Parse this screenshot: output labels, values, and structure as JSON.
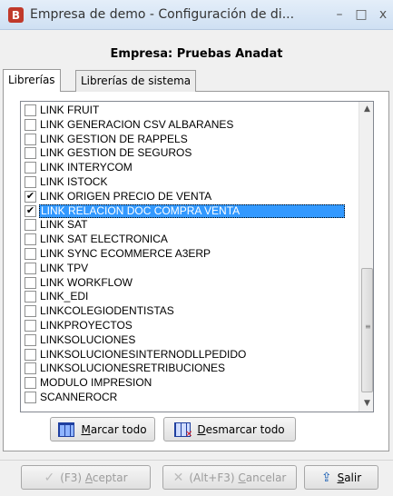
{
  "window": {
    "title": "Empresa de demo - Configuración de di...",
    "app_icon_letter": "B",
    "minimize_glyph": "–",
    "maximize_glyph": "□",
    "close_glyph": "x"
  },
  "company_label": "Empresa: Pruebas Anadat",
  "tabs": [
    {
      "label": "Librerías",
      "active": true
    },
    {
      "label": "Librerías de sistema",
      "active": false
    }
  ],
  "libraries": [
    {
      "label": "LINK FRUIT",
      "checked": false,
      "selected": false
    },
    {
      "label": "LINK GENERACION CSV ALBARANES",
      "checked": false,
      "selected": false
    },
    {
      "label": "LINK GESTION DE RAPPELS",
      "checked": false,
      "selected": false
    },
    {
      "label": "LINK GESTION DE SEGUROS",
      "checked": false,
      "selected": false
    },
    {
      "label": "LINK INTERYCOM",
      "checked": false,
      "selected": false
    },
    {
      "label": "LINK ISTOCK",
      "checked": false,
      "selected": false
    },
    {
      "label": "LINK ORIGEN PRECIO DE VENTA",
      "checked": true,
      "selected": false
    },
    {
      "label": "LINK RELACION DOC COMPRA VENTA",
      "checked": true,
      "selected": true
    },
    {
      "label": "LINK SAT",
      "checked": false,
      "selected": false
    },
    {
      "label": "LINK SAT ELECTRONICA",
      "checked": false,
      "selected": false
    },
    {
      "label": "LINK SYNC ECOMMERCE A3ERP",
      "checked": false,
      "selected": false
    },
    {
      "label": "LINK TPV",
      "checked": false,
      "selected": false
    },
    {
      "label": "LINK WORKFLOW",
      "checked": false,
      "selected": false
    },
    {
      "label": "LINK_EDI",
      "checked": false,
      "selected": false
    },
    {
      "label": "LINKCOLEGIODENTISTAS",
      "checked": false,
      "selected": false
    },
    {
      "label": "LINKPROYECTOS",
      "checked": false,
      "selected": false
    },
    {
      "label": "LINKSOLUCIONES",
      "checked": false,
      "selected": false
    },
    {
      "label": "LINKSOLUCIONESINTERNODLLPEDIDO",
      "checked": false,
      "selected": false
    },
    {
      "label": "LINKSOLUCIONESRETRIBUCIONES",
      "checked": false,
      "selected": false
    },
    {
      "label": "MODULO IMPRESION",
      "checked": false,
      "selected": false
    },
    {
      "label": "SCANNEROCR",
      "checked": false,
      "selected": false
    }
  ],
  "scrollbar": {
    "position_fraction": 0.55
  },
  "buttons": {
    "mark_all": {
      "prefix": "",
      "mnemonic": "M",
      "rest": "arcar todo",
      "icon": "grid-icon"
    },
    "unmark_all": {
      "prefix": "",
      "mnemonic": "D",
      "rest": "esmarcar todo",
      "icon": "grid-x-icon"
    },
    "accept": {
      "prefix": "(F3) ",
      "mnemonic": "A",
      "rest": "ceptar",
      "icon": "check-icon",
      "enabled": false
    },
    "cancel": {
      "prefix": "(Alt+F3) ",
      "mnemonic": "C",
      "rest": "ancelar",
      "icon": "cancel-icon",
      "enabled": false
    },
    "exit": {
      "prefix": "",
      "mnemonic": "S",
      "rest": "alir",
      "icon": "exit-icon",
      "enabled": true
    }
  },
  "colors": {
    "selection": "#3399ff",
    "exit_icon": "#1a5fb4",
    "app_icon": "#c0392b"
  }
}
